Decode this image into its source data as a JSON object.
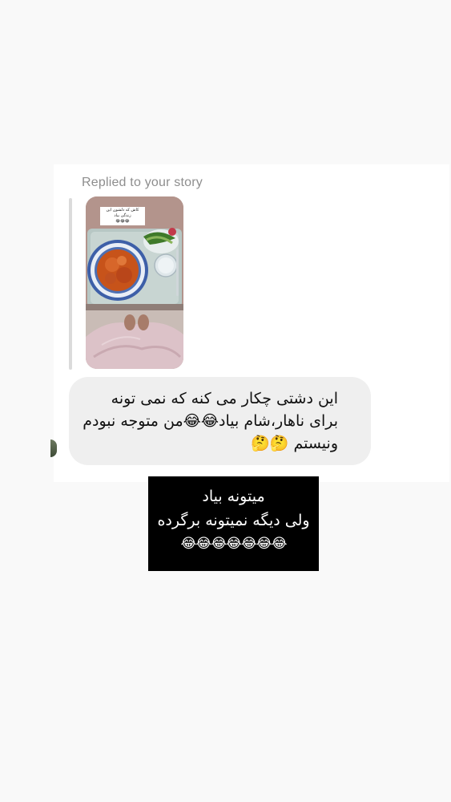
{
  "reply_label": "Replied to your story",
  "story_thumbnail": {
    "caption": "کاش که دلشون این زندگی بیاد",
    "caption_emojis": "😂😂😂",
    "description_icon": "food-tray-image"
  },
  "message": {
    "text": "این دشتی چکار می کنه که نمی تونه برای ناهار،شام بیاد😂😂من متوجه نبودم ونیستم 🤔🤔"
  },
  "overlay": {
    "line1": "میتونه بیاد",
    "line2": "ولی دیگه نمیتونه برگرده",
    "emojis": "😂😂😂😂😂😂😂"
  },
  "colors": {
    "page_bg": "#f9f9f9",
    "card_bg": "#ffffff",
    "bubble_bg": "#efefef",
    "muted_text": "#8e8e8e",
    "overlay_bg": "#000000"
  }
}
